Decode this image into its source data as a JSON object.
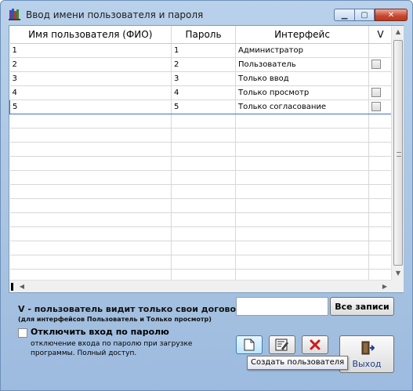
{
  "window": {
    "title": "Ввод имени пользователя и пароля",
    "controls": {
      "minimize": "▁",
      "maximize": "▢",
      "close": "✕"
    }
  },
  "grid": {
    "columns": [
      "Имя пользователя (ФИО)",
      "Пароль",
      "Интерфейс",
      "V"
    ],
    "rows": [
      {
        "name": "1",
        "password": "1",
        "interface": "Администратор",
        "v_checkbox": false
      },
      {
        "name": "2",
        "password": "2",
        "interface": "Пользователь",
        "v_checkbox": true
      },
      {
        "name": "3",
        "password": "3",
        "interface": "Только ввод",
        "v_checkbox": false
      },
      {
        "name": "4",
        "password": "4",
        "interface": "Только просмотр",
        "v_checkbox": true
      },
      {
        "name": "5",
        "password": "5",
        "interface": "Только согласование",
        "v_checkbox": true,
        "selected": true
      }
    ],
    "empty_rows": 12
  },
  "hint": {
    "bold": "V - пользователь видит только свои договоры",
    "small": "(для интерфейсов Пользователь и Только просмотр)"
  },
  "filter": {
    "value": ""
  },
  "buttons": {
    "all_records": "Все записи",
    "exit": "Выход"
  },
  "password_option": {
    "label": "Отключить вход по паролю",
    "description": "отключение входа по паролю при загрузке программы. Полный доступ.",
    "checked": false
  },
  "tooltip": "Создать пользователя",
  "icons": {
    "app": "books-icon",
    "new": "new-document-icon",
    "edit": "edit-document-icon",
    "delete": "red-x-icon",
    "exit": "exit-door-icon"
  },
  "colors": {
    "window_frame": "#a9c4e2",
    "close_button": "#c9462e",
    "selection_border": "#3a73c4",
    "exit_label": "#1f3f8f"
  }
}
